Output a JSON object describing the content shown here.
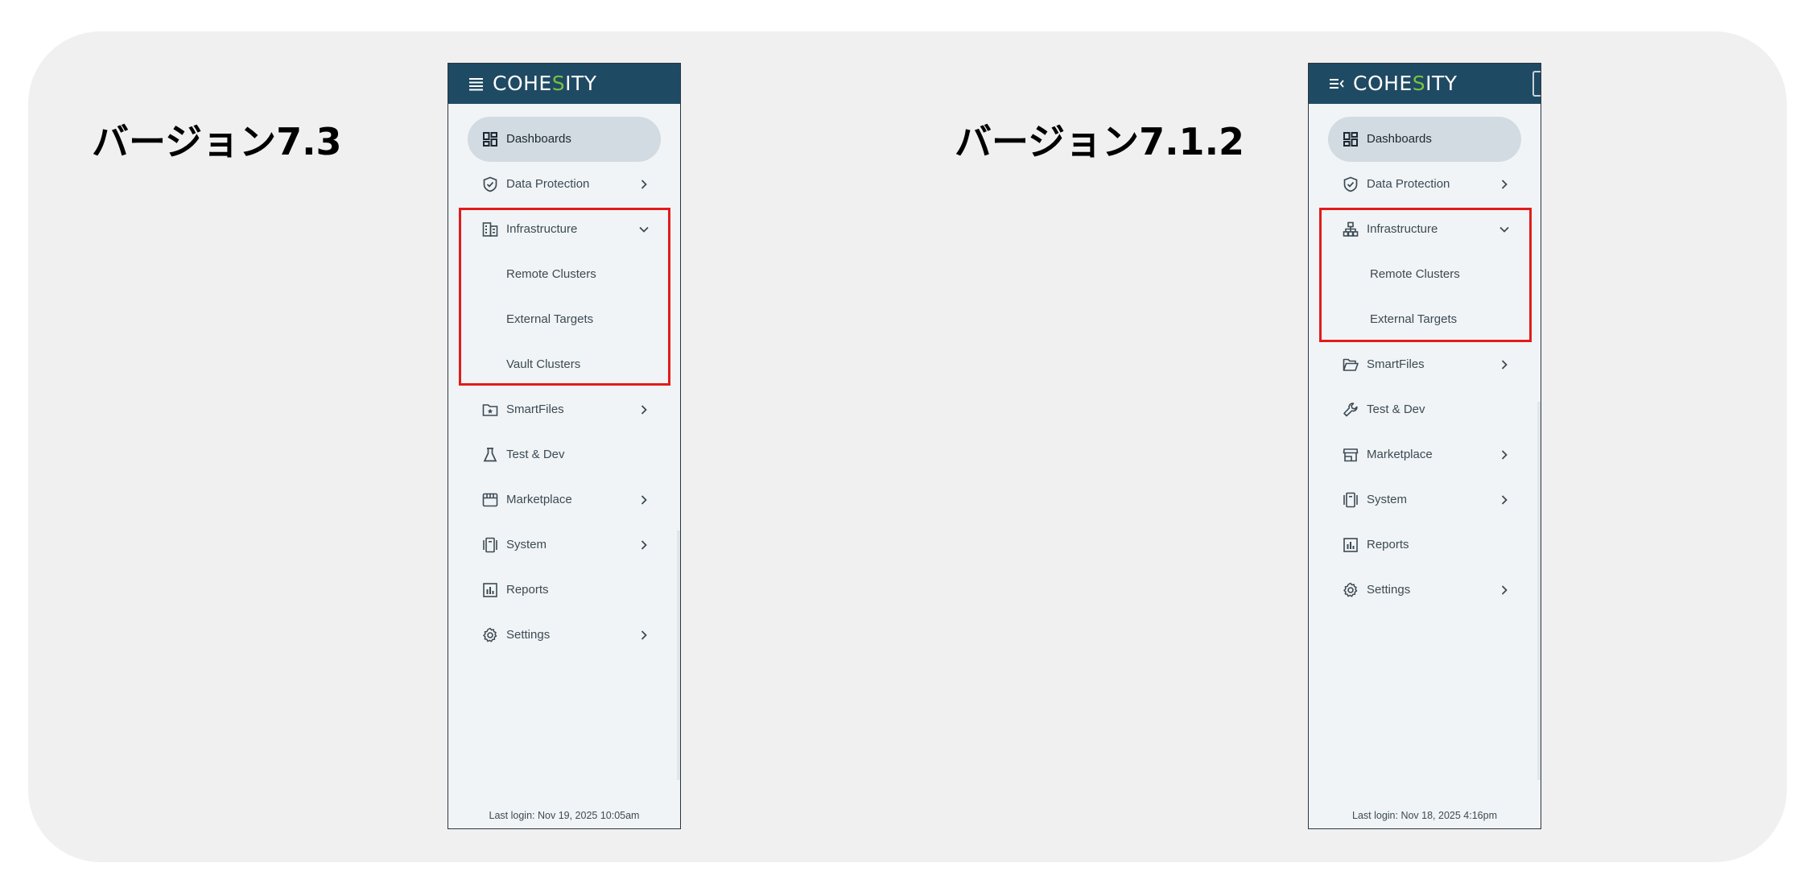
{
  "left": {
    "version_label": "バージョン7.3",
    "logo_prefix": "COHE",
    "logo_mark": "S",
    "logo_suffix": "ITY",
    "nav": {
      "dashboards": "Dashboards",
      "data_protection": "Data Protection",
      "infrastructure": "Infrastructure",
      "remote_clusters": "Remote Clusters",
      "external_targets": "External Targets",
      "vault_clusters": "Vault Clusters",
      "smartfiles": "SmartFiles",
      "test_dev": "Test & Dev",
      "marketplace": "Marketplace",
      "system": "System",
      "reports": "Reports",
      "settings": "Settings"
    },
    "last_login": "Last login: Nov 19, 2025 10:05am"
  },
  "right": {
    "version_label": "バージョン7.1.2",
    "logo_prefix": "COHE",
    "logo_mark": "S",
    "logo_suffix": "ITY",
    "nav": {
      "dashboards": "Dashboards",
      "data_protection": "Data Protection",
      "infrastructure": "Infrastructure",
      "remote_clusters": "Remote Clusters",
      "external_targets": "External Targets",
      "smartfiles": "SmartFiles",
      "test_dev": "Test & Dev",
      "marketplace": "Marketplace",
      "system": "System",
      "reports": "Reports",
      "settings": "Settings"
    },
    "last_login": "Last login: Nov 18, 2025 4:16pm"
  },
  "colors": {
    "header_bg": "#1f4a63",
    "logo_accent": "#7ac143",
    "highlight_border": "#e31b1b",
    "active_item_bg": "#d2dbe1",
    "stage_bg": "#f0f0f0"
  }
}
